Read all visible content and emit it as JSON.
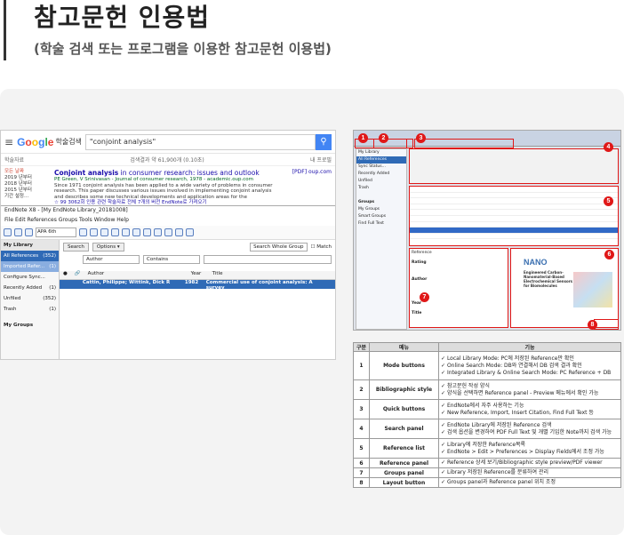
{
  "header": {
    "title": "참고문헌 인용법",
    "subtitle": "(학술 검색 또는 프로그램을 이용한 참고문헌 이용법)"
  },
  "google": {
    "logo_letters": [
      "G",
      "o",
      "o",
      "g",
      "l",
      "e"
    ],
    "scholar": "학술검색",
    "query": "\"conjoint analysis\"",
    "results_label": "학술자료",
    "results_count": "검색결과 약 61,900개 (0.10초)",
    "my_library": "내 프로필",
    "side": [
      "모든 날짜",
      "2019 년부터",
      "2018 년부터",
      "2015 년부터",
      "기간 설정..."
    ],
    "result_title_bold": "Conjoint analysis",
    "result_title_rest": " in consumer research: issues and outlook",
    "result_authors": "PE Green, V Srinivasan - Journal of consumer research, 1978 - academic.oup.com",
    "result_snippet_1": "Since 1971 conjoint analysis has been applied to a wide variety of problems in consumer",
    "result_snippet_2": "research. This paper discusses various issues involved in implementing conjoint analysis",
    "result_snippet_3": "and describes some new technical developments and application areas for the",
    "result_links": "☆  99  3062회 인용  관련 학술자료  전체 7개의 버전  EndNote로 가져오기",
    "pdf": "[PDF] oup.com"
  },
  "endnote": {
    "window_title": "EndNote X8 - [My EndNote Library_20181008]",
    "menu": "File  Edit  References  Groups  Tools  Window  Help",
    "style": "APA 6th",
    "library_header": "My Library",
    "library": [
      {
        "label": "All References",
        "count": "(352)",
        "sel": true
      },
      {
        "label": "Imported Refer...",
        "count": "(1)",
        "sel": false
      },
      {
        "label": "Configure Sync...",
        "count": "",
        "sel": false
      },
      {
        "label": "Recently Added",
        "count": "(1)",
        "sel": false
      },
      {
        "label": "Unfiled",
        "count": "(352)",
        "sel": false
      },
      {
        "label": "Trash",
        "count": "(1)",
        "sel": false
      },
      {
        "label": "My Groups",
        "count": "",
        "sel": false
      }
    ],
    "search_btn": "Search",
    "options_btn": "Options ▾",
    "search_scope": "Search Whole Group",
    "match": "Match",
    "field": "Author",
    "operator": "Contains",
    "cols": [
      "●",
      "🔗",
      "Author",
      "Year",
      "Title"
    ],
    "row": [
      "",
      "",
      "Cattin, Philippe; Wittink, Dick R",
      "1982",
      "Commercial use of conjoint analysis: A survey"
    ]
  },
  "shot2": {
    "left_items": [
      "My Library",
      "All References",
      "Sync Status...",
      "Recently Added",
      "Unfiled",
      "Trash",
      "",
      "Groups",
      "My Groups",
      "Smart Groups",
      "Find Full Text"
    ],
    "nano": "NANO",
    "paper_title": "Engineered Carbon-Nanomaterial-Based Electrochemical Sensors for Biomolecules",
    "ref_fields": [
      "Reference",
      "Rating",
      "Author",
      "Year",
      "Title"
    ],
    "numbers": [
      "1",
      "2",
      "3",
      "4",
      "5",
      "6",
      "7",
      "8"
    ]
  },
  "table": {
    "headers": [
      "구분",
      "메뉴",
      "기능"
    ],
    "rows": [
      {
        "num": "1",
        "menu": "Mode buttons",
        "funcs": [
          "Local Library Mode: PC에 저장된 Reference만 확인",
          "Online Search Mode: DB와 연결해서 DB 검색 결과 확인",
          "Integrated Library & Online Search Mode: PC Reference + DB"
        ]
      },
      {
        "num": "2",
        "menu": "Bibliographic style",
        "funcs": [
          "참고문헌 작성 양식",
          "양식을 선택하면 Reference panel - Preview 메뉴에서 확인 가능"
        ]
      },
      {
        "num": "3",
        "menu": "Quick buttons",
        "funcs": [
          "EndNote에서 자주 사용하는 기능",
          "New Reference, Import, Insert Citation, Find Full Text 등"
        ]
      },
      {
        "num": "4",
        "menu": "Search panel",
        "funcs": [
          "EndNote Library에 저장된 Reference 검색",
          "검색 옵션을 변경하여 PDF Full Text 및 개별 기입한 Note까지 검색 가능"
        ]
      },
      {
        "num": "5",
        "menu": "Reference list",
        "funcs": [
          "Library에 저장한 Reference목록",
          "EndNote > Edit > Preferences > Display Fields에서 조정 가능"
        ]
      },
      {
        "num": "6",
        "menu": "Reference panel",
        "funcs": [
          "Reference 상세 보기/Bibliographic style preview/PDF viewer"
        ]
      },
      {
        "num": "7",
        "menu": "Groups panel",
        "funcs": [
          "Library 저장된 Reference를 분류하여 관리"
        ]
      },
      {
        "num": "8",
        "menu": "Layout button",
        "funcs": [
          "Groups panel과 Reference panel 위치 조정"
        ]
      }
    ]
  }
}
